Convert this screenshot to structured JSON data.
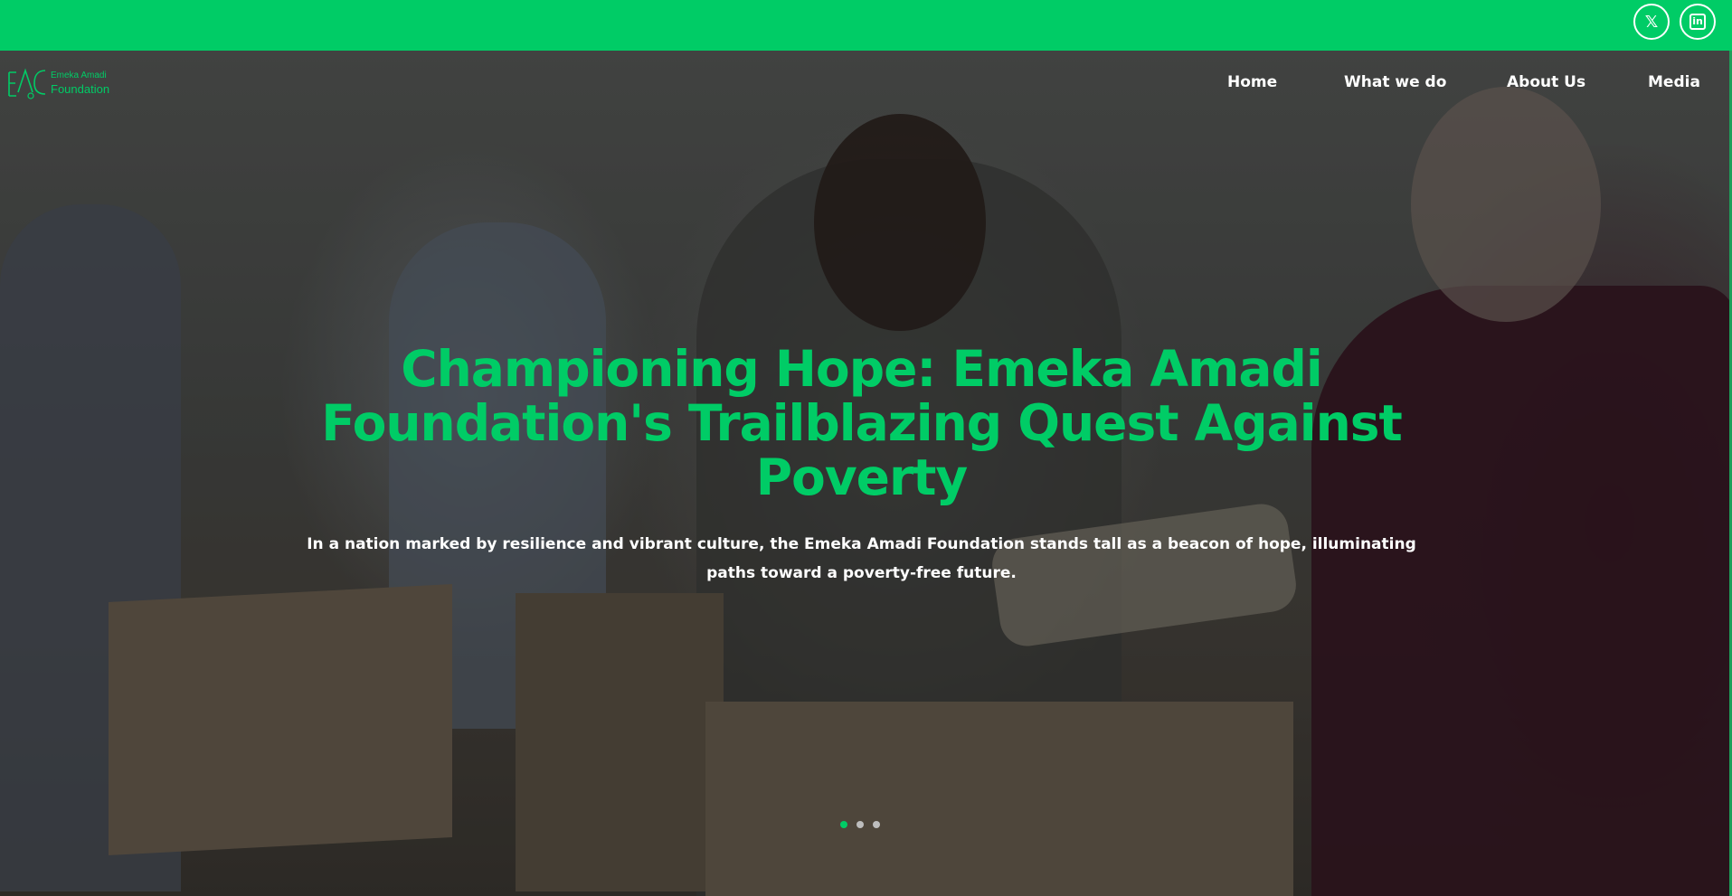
{
  "colors": {
    "brand_green": "#00cc66",
    "nav_text": "#ffffff"
  },
  "social": [
    {
      "name": "x-icon",
      "glyph": "𝕏"
    },
    {
      "name": "linkedin-icon",
      "glyph": "in"
    }
  ],
  "logo": {
    "line1": "Emeka Amadi",
    "line2": "Foundation"
  },
  "nav": {
    "items": [
      "Home",
      "What we do",
      "About Us",
      "Media"
    ]
  },
  "hero": {
    "headline": "Championing Hope: Emeka Amadi Foundation's Trailblazing Quest Against Poverty",
    "subheading": "In a nation marked by resilience and vibrant culture, the Emeka Amadi Foundation stands tall as a beacon of hope, illuminating paths toward a poverty-free future."
  },
  "carousel": {
    "slide_count": 3,
    "active_slide": 1
  }
}
